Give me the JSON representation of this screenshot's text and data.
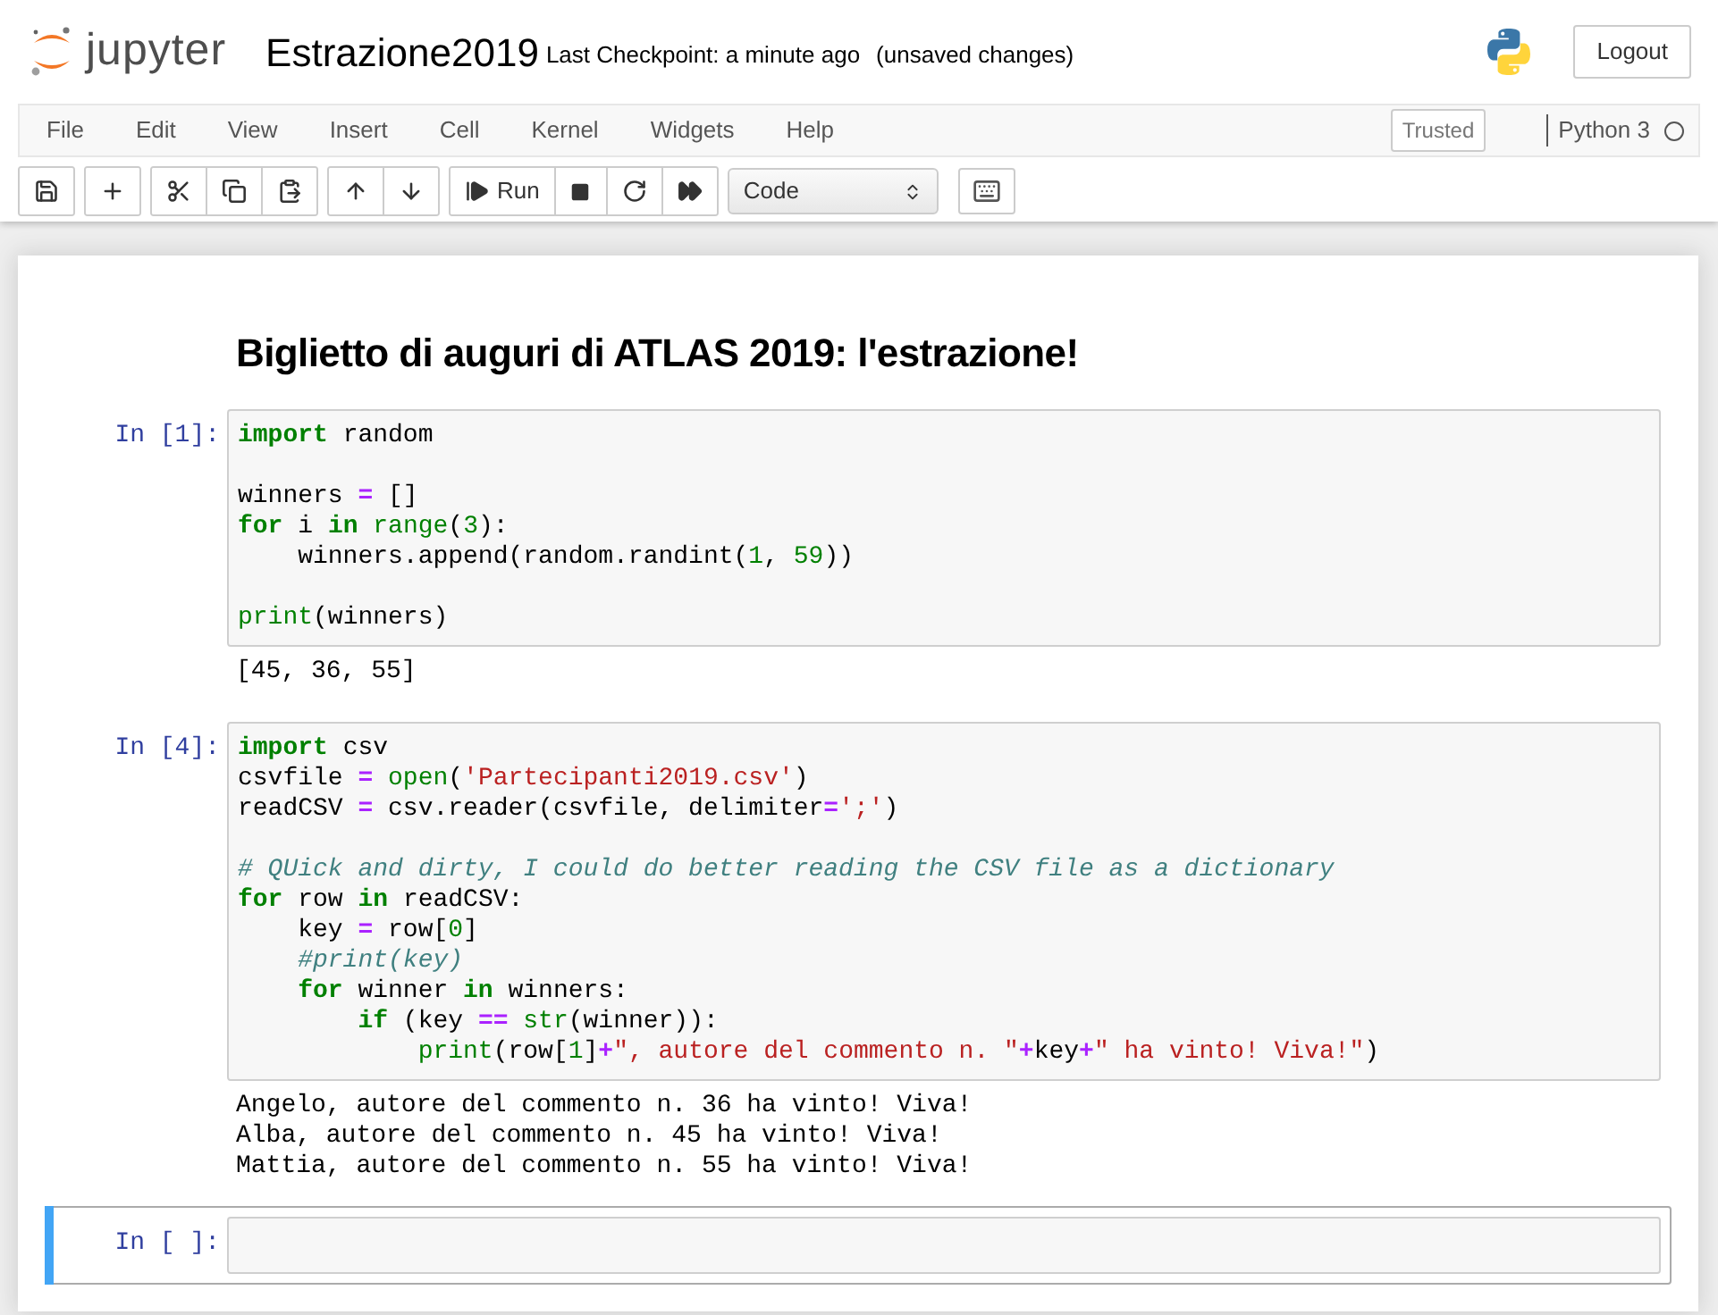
{
  "header": {
    "logo_text": "jupyter",
    "title": "Estrazione2019",
    "checkpoint": "Last Checkpoint: a minute ago",
    "unsaved": "(unsaved changes)",
    "logout": "Logout"
  },
  "menu": [
    "File",
    "Edit",
    "View",
    "Insert",
    "Cell",
    "Kernel",
    "Widgets",
    "Help"
  ],
  "trusted": "Trusted",
  "kernel": {
    "name": "Python 3",
    "busy": false
  },
  "toolbar": {
    "run_label": "Run"
  },
  "cell_type_select": "Code",
  "cells": [
    {
      "kind": "markdown",
      "selected": false,
      "heading": "Biglietto di auguri di ATLAS 2019: l'estrazione!"
    },
    {
      "kind": "code",
      "selected": false,
      "prompt": "In [1]:",
      "blocks": [
        [
          [
            {
              "kind": "kw",
              "text": "import"
            },
            {
              "kind": "plain",
              "text": " random"
            }
          ]
        ],
        [
          [
            {
              "kind": "plain",
              "text": "winners "
            },
            {
              "kind": "op",
              "text": "="
            },
            {
              "kind": "plain",
              "text": " []"
            }
          ],
          [
            {
              "kind": "kw",
              "text": "for"
            },
            {
              "kind": "plain",
              "text": " i "
            },
            {
              "kind": "kw",
              "text": "in"
            },
            {
              "kind": "builtin",
              "text": " range"
            },
            {
              "kind": "plain",
              "text": "("
            },
            {
              "kind": "num",
              "text": "3"
            },
            {
              "kind": "plain",
              "text": "):"
            }
          ],
          [
            {
              "kind": "plain",
              "text": "    winners.append(random.randint("
            },
            {
              "kind": "num",
              "text": "1"
            },
            {
              "kind": "plain",
              "text": ", "
            },
            {
              "kind": "num",
              "text": "59"
            },
            {
              "kind": "plain",
              "text": "))"
            }
          ]
        ],
        [
          [
            {
              "kind": "builtin",
              "text": "print"
            },
            {
              "kind": "plain",
              "text": "(winners)"
            }
          ]
        ]
      ],
      "output": [
        "[45, 36, 55]"
      ]
    },
    {
      "kind": "code",
      "selected": false,
      "prompt": "In [4]:",
      "blocks": [
        [
          [
            {
              "kind": "kw",
              "text": "import"
            },
            {
              "kind": "plain",
              "text": " csv"
            }
          ],
          [
            {
              "kind": "plain",
              "text": "csvfile "
            },
            {
              "kind": "op",
              "text": "="
            },
            {
              "kind": "builtin",
              "text": " open"
            },
            {
              "kind": "plain",
              "text": "("
            },
            {
              "kind": "str",
              "text": "'Partecipanti2019.csv'"
            },
            {
              "kind": "plain",
              "text": ")"
            }
          ],
          [
            {
              "kind": "plain",
              "text": "readCSV "
            },
            {
              "kind": "op",
              "text": "="
            },
            {
              "kind": "plain",
              "text": " csv.reader(csvfile, delimiter"
            },
            {
              "kind": "op",
              "text": "="
            },
            {
              "kind": "str",
              "text": "';'"
            },
            {
              "kind": "plain",
              "text": ")"
            }
          ]
        ],
        [
          [
            {
              "kind": "comment",
              "text": "# QUick and dirty, I could do better reading the CSV file as a dictionary"
            }
          ],
          [
            {
              "kind": "kw",
              "text": "for"
            },
            {
              "kind": "plain",
              "text": " row "
            },
            {
              "kind": "kw",
              "text": "in"
            },
            {
              "kind": "plain",
              "text": " readCSV:"
            }
          ],
          [
            {
              "kind": "plain",
              "text": "    key "
            },
            {
              "kind": "op",
              "text": "="
            },
            {
              "kind": "plain",
              "text": " row["
            },
            {
              "kind": "num",
              "text": "0"
            },
            {
              "kind": "plain",
              "text": "]"
            }
          ],
          [
            {
              "kind": "comment",
              "text": "    #print(key)"
            }
          ],
          [
            {
              "kind": "kw",
              "text": "    for"
            },
            {
              "kind": "plain",
              "text": " winner "
            },
            {
              "kind": "kw",
              "text": "in"
            },
            {
              "kind": "plain",
              "text": " winners:"
            }
          ],
          [
            {
              "kind": "kw",
              "text": "        if"
            },
            {
              "kind": "plain",
              "text": " (key "
            },
            {
              "kind": "op",
              "text": "=="
            },
            {
              "kind": "builtin",
              "text": " str"
            },
            {
              "kind": "plain",
              "text": "(winner)):"
            }
          ],
          [
            {
              "kind": "builtin",
              "text": "            print"
            },
            {
              "kind": "plain",
              "text": "(row["
            },
            {
              "kind": "num",
              "text": "1"
            },
            {
              "kind": "plain",
              "text": "]"
            },
            {
              "kind": "op",
              "text": "+"
            },
            {
              "kind": "str",
              "text": "\", autore del commento n. \""
            },
            {
              "kind": "op",
              "text": "+"
            },
            {
              "kind": "plain",
              "text": "key"
            },
            {
              "kind": "op",
              "text": "+"
            },
            {
              "kind": "str",
              "text": "\" ha vinto! Viva!\""
            },
            {
              "kind": "plain",
              "text": ")"
            }
          ]
        ]
      ],
      "output": [
        "Angelo, autore del commento n. 36 ha vinto! Viva!",
        "Alba, autore del commento n. 45 ha vinto! Viva!",
        "Mattia, autore del commento n. 55 ha vinto! Viva!"
      ]
    },
    {
      "kind": "code",
      "selected": true,
      "prompt": "In [ ]:"
    }
  ]
}
